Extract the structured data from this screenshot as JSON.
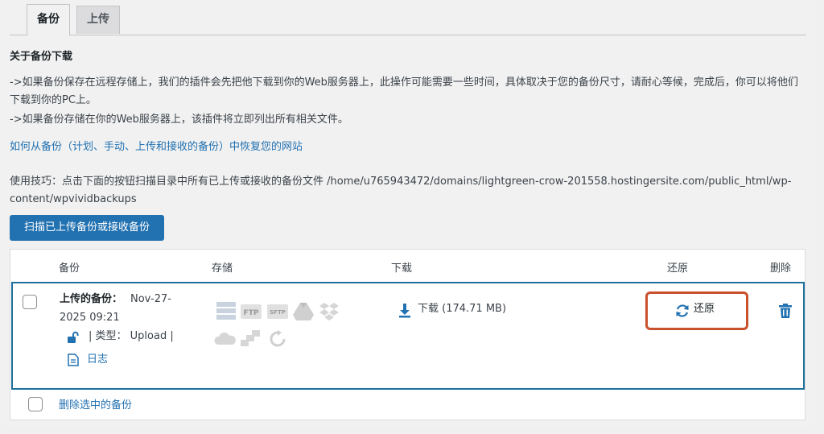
{
  "tabs": [
    {
      "label": "备份"
    },
    {
      "label": "上传"
    }
  ],
  "about": {
    "title": "关于备份下载",
    "p1": "->如果备份保存在远程存储上，我们的插件会先把他下载到你的Web服务器上，此操作可能需要一些时间，具体取决于您的备份尺寸，请耐心等候，完成后，你可以将他们下载到你的PC上。",
    "p2": "->如果备份存储在你的Web服务器上，该插件将立即列出所有相关文件。",
    "link": "如何从备份（计划、手动、上传和接收的备份）中恢复您的网站",
    "tip": "使用技巧：点击下面的按钮扫描目录中所有已上传或接收的备份文件 /home/u765943472/domains/lightgreen-crow-201558.hostingersite.com/public_html/wp-content/wpvividbackups"
  },
  "scan_button": "扫描已上传备份或接收备份",
  "table": {
    "headers": {
      "backup": "备份",
      "storage": "存储",
      "download": "下载",
      "restore": "还原",
      "delete": "删除"
    },
    "row": {
      "label": "上传的备份：",
      "date_line1": "Nov-27-",
      "date_line2": "2025 09:21",
      "type": "| 类型：  Upload |",
      "log": "日志",
      "storage_icons": [
        "server-icon",
        "ftp-icon",
        "sftp-icon",
        "google-drive-icon",
        "dropbox-icon",
        "onedrive-icon",
        "amazon-s3-icon",
        "sync-icon"
      ],
      "download": "下载 (174.71 MB)",
      "restore": "还原"
    },
    "footer_link": "删除选中的备份"
  },
  "colors": {
    "accent": "#2271b1",
    "highlight": "#c9512c",
    "row_border": "#1f6e9b"
  }
}
